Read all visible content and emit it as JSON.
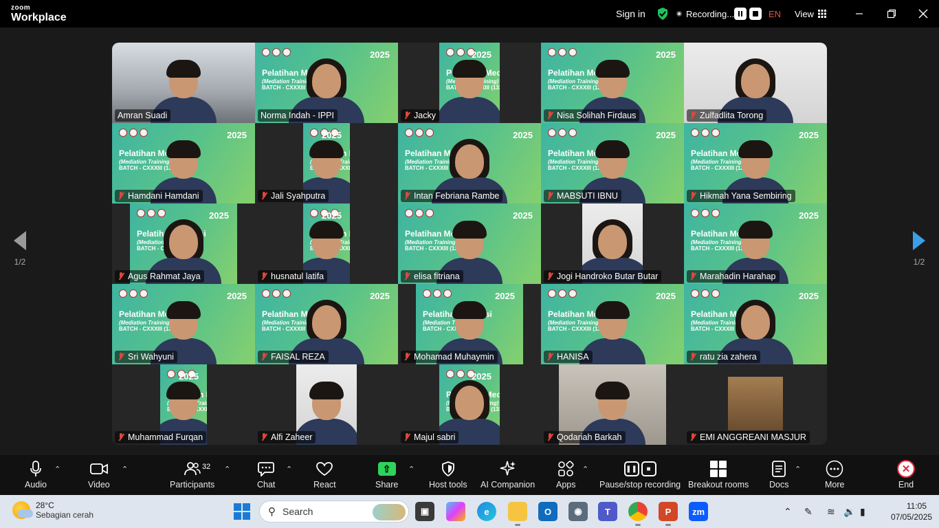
{
  "app": {
    "brand_top": "zoom",
    "brand_bottom": "Workplace"
  },
  "titlebar": {
    "sign_in": "Sign in",
    "recording": "Recording...",
    "language": "EN",
    "view": "View"
  },
  "pagination": {
    "left": "1/2",
    "right": "1/2"
  },
  "banner": {
    "title": "Pelatihan Mediasi",
    "subtitle": "(Mediation Training)",
    "batch": "BATCH - CXXXIII (133)",
    "year": "2025"
  },
  "participants": [
    {
      "name": "Amran Suadi",
      "muted": false,
      "bg": "room"
    },
    {
      "name": "Norma Indah - IPPI",
      "muted": false,
      "bg": "green",
      "active": true
    },
    {
      "name": "Jacky",
      "muted": true,
      "bg": "green"
    },
    {
      "name": "Nisa Solihah Firdaus",
      "muted": true,
      "bg": "green"
    },
    {
      "name": "Zulfadlita Torong",
      "muted": true,
      "bg": "white"
    },
    {
      "name": "Hamdani Hamdani",
      "muted": true,
      "bg": "green"
    },
    {
      "name": "Jali Syahputra",
      "muted": true,
      "bg": "green"
    },
    {
      "name": "Intan Febriana Rambe",
      "muted": true,
      "bg": "green"
    },
    {
      "name": "MABSUTI IBNU",
      "muted": true,
      "bg": "green"
    },
    {
      "name": "Hikmah Yana Sembiring",
      "muted": true,
      "bg": "green"
    },
    {
      "name": "Agus Rahmat Jaya",
      "muted": true,
      "bg": "green"
    },
    {
      "name": "husnatul latifa",
      "muted": true,
      "bg": "green"
    },
    {
      "name": "elisa fitriana",
      "muted": true,
      "bg": "green"
    },
    {
      "name": "Jogi Handroko Butar Butar",
      "muted": true,
      "bg": "white"
    },
    {
      "name": "Marahadin Harahap",
      "muted": true,
      "bg": "green"
    },
    {
      "name": "Sri Wahyuni",
      "muted": true,
      "bg": "green"
    },
    {
      "name": "FAISAL REZA",
      "muted": true,
      "bg": "green"
    },
    {
      "name": "Mohamad Muhaymin",
      "muted": true,
      "bg": "green"
    },
    {
      "name": "HANISA",
      "muted": true,
      "bg": "green"
    },
    {
      "name": "ratu zia zahera",
      "muted": true,
      "bg": "green"
    },
    {
      "name": "Muhammad Furqan",
      "muted": true,
      "bg": "green"
    },
    {
      "name": "Alfi Zaheer",
      "muted": true,
      "bg": "white"
    },
    {
      "name": "Majul sabri",
      "muted": true,
      "bg": "green"
    },
    {
      "name": "Qodariah Barkah",
      "muted": true,
      "bg": "grey"
    },
    {
      "name": "EMI ANGGREANI MASJUR",
      "muted": true,
      "bg": "brown"
    }
  ],
  "toolbar": {
    "audio": "Audio",
    "video": "Video",
    "participants": "Participants",
    "participant_count": "32",
    "chat": "Chat",
    "react": "React",
    "share": "Share",
    "host_tools": "Host tools",
    "ai_companion": "AI Companion",
    "apps": "Apps",
    "pause_stop_recording": "Pause/stop recording",
    "breakout_rooms": "Breakout rooms",
    "docs": "Docs",
    "more": "More",
    "end": "End"
  },
  "taskbar": {
    "temperature": "28°C",
    "weather": "Sebagian cerah",
    "search_placeholder": "Search",
    "time": "11:05",
    "date": "07/05/2025"
  }
}
